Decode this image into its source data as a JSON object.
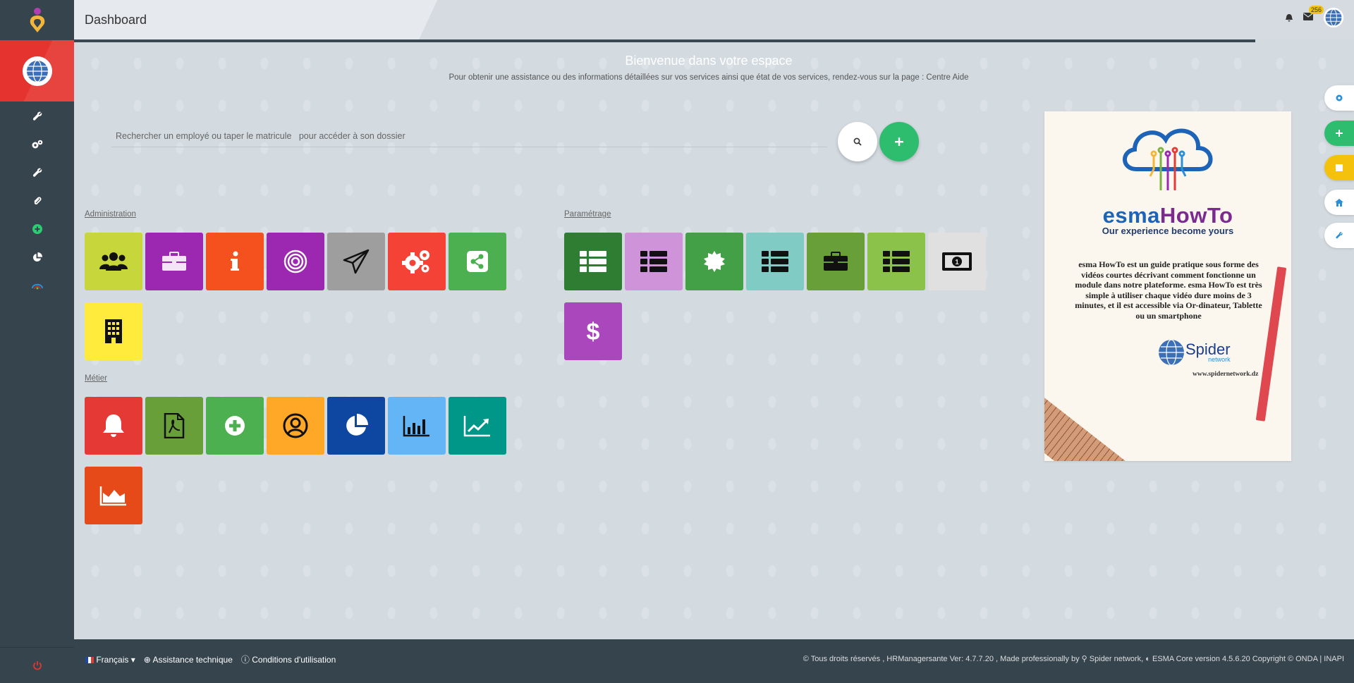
{
  "header": {
    "title": "Dashboard",
    "mail_badge": "256"
  },
  "welcome": {
    "title": "Bienvenue dans votre espace",
    "subtitle": "Pour obtenir une assistance ou des informations détaillées sur vos services ainsi que état de vos services, rendez-vous sur la page : Centre Aide"
  },
  "search": {
    "placeholder": "Rechercher un employé ou taper le matricule   pour accéder à son dossier"
  },
  "sections": {
    "administration": {
      "label": "Administration",
      "tiles": [
        {
          "name": "users-icon",
          "color": "#c7d63a"
        },
        {
          "name": "briefcase-icon",
          "color": "#9c27b0"
        },
        {
          "name": "info-icon",
          "color": "#f4511e"
        },
        {
          "name": "target-icon",
          "color": "#9c27b0"
        },
        {
          "name": "paper-plane-icon",
          "color": "#9e9e9e"
        },
        {
          "name": "gears-icon",
          "color": "#f44336"
        },
        {
          "name": "share-icon",
          "color": "#4caf50"
        },
        {
          "name": "building-icon",
          "color": "#ffeb3b"
        }
      ]
    },
    "parametrage": {
      "label": "Paramétrage",
      "tiles": [
        {
          "name": "table-icon",
          "color": "#2e7d32"
        },
        {
          "name": "list-icon",
          "color": "#ce93d8"
        },
        {
          "name": "certificate-icon",
          "color": "#43a047"
        },
        {
          "name": "list-icon",
          "color": "#80cbc4"
        },
        {
          "name": "briefcase-icon",
          "color": "#689f38"
        },
        {
          "name": "list-icon",
          "color": "#8bc34a"
        },
        {
          "name": "money-icon",
          "color": "#e0e0e0"
        },
        {
          "name": "dollar-icon",
          "color": "#ab47bc"
        }
      ]
    },
    "metier": {
      "label": "Métier",
      "tiles": [
        {
          "name": "bell-icon",
          "color": "#e53935"
        },
        {
          "name": "pdf-file-icon",
          "color": "#689f38"
        },
        {
          "name": "plus-circle-icon",
          "color": "#4caf50"
        },
        {
          "name": "user-circle-icon",
          "color": "#ffa726"
        },
        {
          "name": "pie-chart-icon",
          "color": "#0d47a1"
        },
        {
          "name": "bar-chart-icon",
          "color": "#64b5f6"
        },
        {
          "name": "line-chart-icon",
          "color": "#009688"
        },
        {
          "name": "area-chart-icon",
          "color": "#e64a19"
        }
      ]
    }
  },
  "promo": {
    "brand_esma": "esma",
    "brand_howto": "HowTo",
    "tagline": "Our experience become yours",
    "body": "esma HowTo est un guide pratique sous forme des vidéos courtes décrivant comment fonctionne un module dans notre plateforme. esma HowTo est très simple à utiliser chaque vidéo dure moins de 3 minutes, et il est accessible via Or-dinateur, Tablette ou un smartphone",
    "spider": "Spider",
    "spider_sub": "network",
    "site": "www.spidernetwork.dz"
  },
  "footer": {
    "language": "Français",
    "support": "Assistance technique",
    "terms": "Conditions d'utilisation",
    "copyright": "© Tous droits réservés , HRManagersante Ver: 4.7.7.20 , Made professionally by ⚲ Spider network, ◐ ESMA Core version 4.5.6.20 Copyright © ONDA | INAPI"
  }
}
